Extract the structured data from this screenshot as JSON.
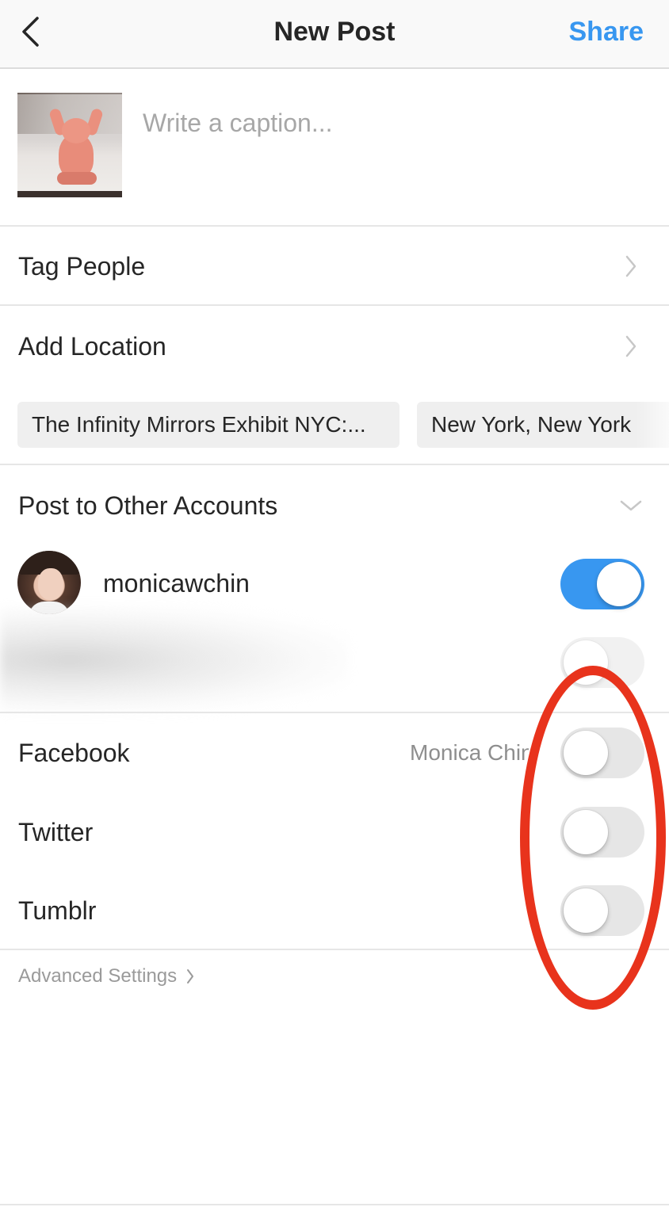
{
  "header": {
    "title": "New Post",
    "share_label": "Share"
  },
  "caption": {
    "placeholder": "Write a caption...",
    "value": ""
  },
  "rows": {
    "tag_people": "Tag People",
    "add_location": "Add Location",
    "post_to_other_accounts": "Post to Other Accounts"
  },
  "location_suggestions": [
    "The Infinity Mirrors Exhibit NYC:...",
    "New York, New York"
  ],
  "accounts": [
    {
      "username": "monicawchin",
      "enabled": true
    },
    {
      "username": "",
      "enabled": false
    }
  ],
  "share_to": [
    {
      "label": "Facebook",
      "account": "Monica Chin",
      "enabled": false
    },
    {
      "label": "Twitter",
      "account": "",
      "enabled": false
    },
    {
      "label": "Tumblr",
      "account": "",
      "enabled": false
    }
  ],
  "advanced_settings": "Advanced Settings",
  "colors": {
    "accent": "#3897f0",
    "annotation": "#e8331c",
    "toggle_off": "#e6e6e6"
  },
  "icons": {
    "back": "chevron-left-icon",
    "row_chevron": "chevron-right-icon",
    "expand": "chevron-down-icon"
  }
}
